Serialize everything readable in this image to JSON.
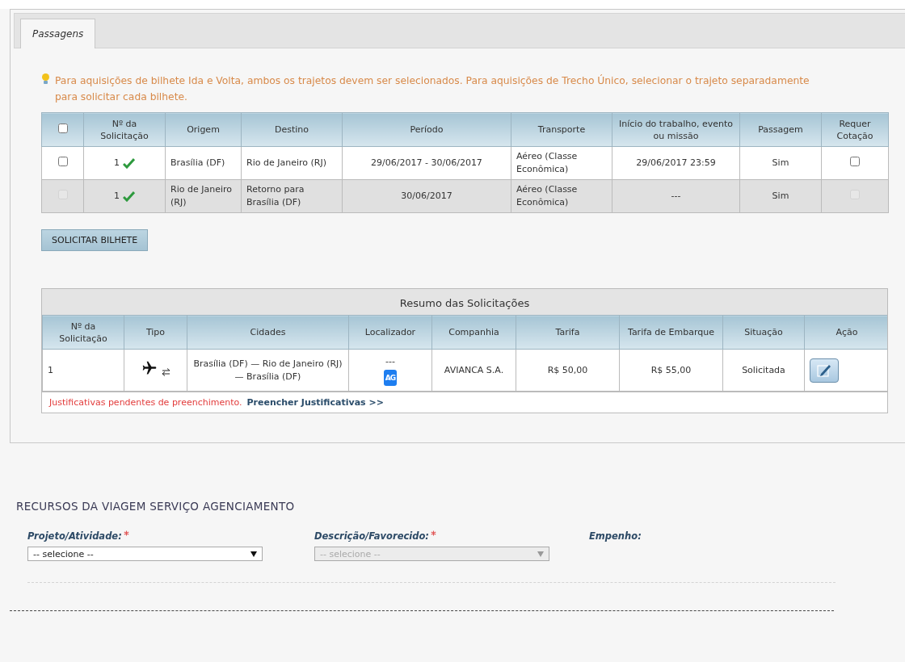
{
  "tabs": [
    {
      "label": "Passagens",
      "selected": true
    }
  ],
  "hint": "Para aquisições de bilhete Ida e Volta, ambos os trajetos devem ser selecionados. Para aquisições de Trecho Único, selecionar o trajeto separadamente para solicitar cada bilhete.",
  "trips": {
    "select_all_checked": false,
    "columns": [
      "Nº da Solicitação",
      "Origem",
      "Destino",
      "Período",
      "Transporte",
      "Início do trabalho, evento ou missão",
      "Passagem",
      "Requer Cotação"
    ],
    "rows": [
      {
        "checked": false,
        "disabled": false,
        "number": "1",
        "confirmed": true,
        "origin": "Brasília (DF)",
        "destination": "Rio de Janeiro (RJ)",
        "period": "29/06/2017 - 30/06/2017",
        "transport": "Aéreo (Classe Econômica)",
        "start": "29/06/2017 23:59",
        "ticket": "Sim",
        "quote_checked": false
      },
      {
        "checked": false,
        "disabled": true,
        "number": "1",
        "confirmed": true,
        "origin": "Rio de Janeiro (RJ)",
        "destination": "Retorno para Brasília (DF)",
        "period": "30/06/2017",
        "transport": "Aéreo (Classe Econômica)",
        "start": "---",
        "ticket": "Sim",
        "quote_checked": false
      }
    ]
  },
  "request_button": "SOLICITAR BILHETE",
  "summary": {
    "title": "Resumo das Solicitações",
    "columns": [
      "Nº da Solicitação",
      "Tipo",
      "Cidades",
      "Localizador",
      "Companhia",
      "Tarifa",
      "Tarifa de Embarque",
      "Situação",
      "Ação"
    ],
    "rows": [
      {
        "number": "1",
        "cities": "Brasília (DF) — Rio de Janeiro (RJ) — Brasília (DF)",
        "locator": "---",
        "agency_badge": "AG",
        "company": "AVIANCA S.A.",
        "fare": "R$ 50,00",
        "boarding_fee": "R$ 55,00",
        "status": "Solicitada"
      }
    ],
    "warning": "Justificativas pendentes de preenchimento.",
    "link": "Preencher Justificativas >>"
  },
  "resources": {
    "heading": "RECURSOS DA VIAGEM SERVIÇO AGENCIAMENTO",
    "fields": [
      {
        "label": "Projeto/Atividade:",
        "required": true,
        "select": {
          "placeholder": "-- selecione --",
          "disabled": false
        }
      },
      {
        "label": "Descrição/Favorecido:",
        "required": true,
        "select": {
          "placeholder": "-- selecione --",
          "disabled": true
        }
      },
      {
        "label": "Empenho:",
        "required": false
      }
    ]
  }
}
